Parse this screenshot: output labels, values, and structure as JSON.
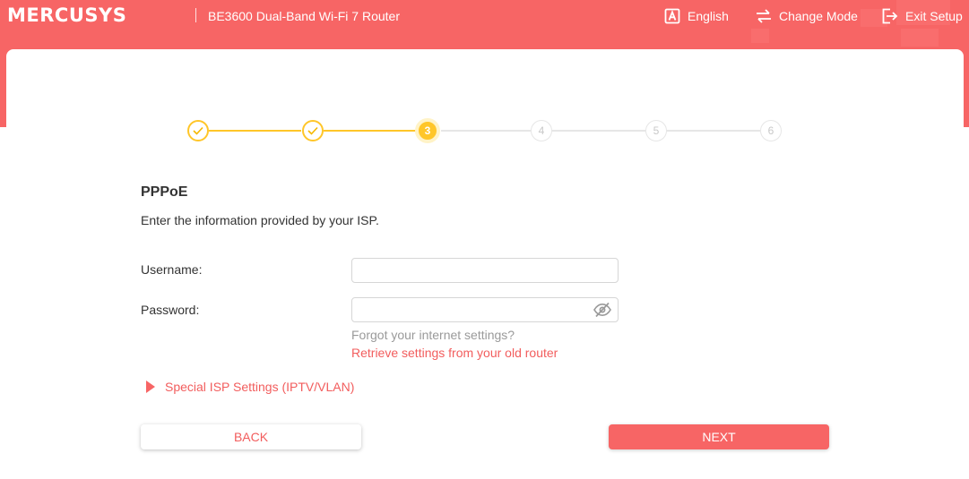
{
  "header": {
    "brand": "MERCUSYS",
    "model": "BE3600 Dual-Band Wi-Fi 7 Router",
    "language_label": "English",
    "change_mode_label": "Change Mode",
    "exit_setup_label": "Exit Setup"
  },
  "stepper": {
    "steps": [
      {
        "label": "",
        "state": "done"
      },
      {
        "label": "",
        "state": "done"
      },
      {
        "label": "3",
        "state": "current"
      },
      {
        "label": "4",
        "state": "todo"
      },
      {
        "label": "5",
        "state": "todo"
      },
      {
        "label": "6",
        "state": "todo"
      }
    ],
    "completed_color": "#ffc629",
    "pending_color": "#e6e6e6"
  },
  "form": {
    "title": "PPPoE",
    "subtitle": "Enter the information provided by your ISP.",
    "username_label": "Username:",
    "username_value": "",
    "password_label": "Password:",
    "password_value": "",
    "forgot_text": "Forgot your internet settings?",
    "retrieve_link": "Retrieve settings from your old router",
    "special_isp_label": "Special ISP Settings (IPTV/VLAN)"
  },
  "buttons": {
    "back_label": "BACK",
    "next_label": "NEXT"
  },
  "colors": {
    "brand": "#f76565",
    "accent_text": "#f25d5d",
    "step_active": "#ffc629"
  }
}
